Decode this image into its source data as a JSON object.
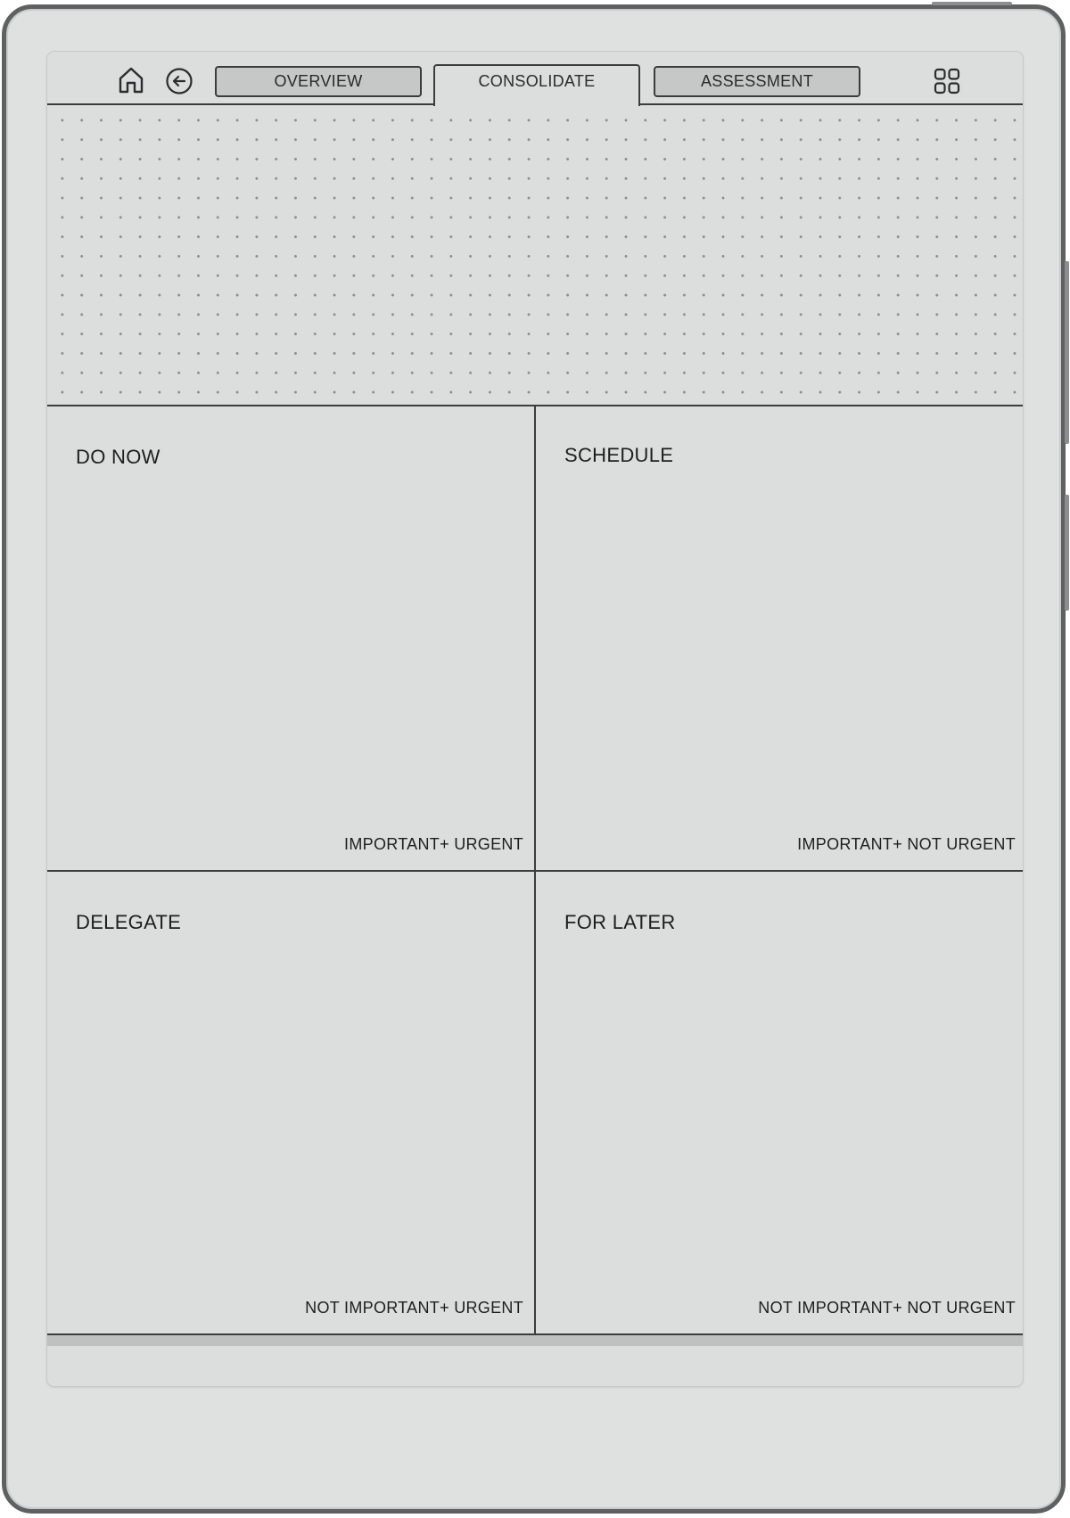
{
  "nav": {
    "home_icon": "home-icon",
    "back_icon": "back-arrow-icon",
    "tabs": [
      {
        "label": "OVERVIEW",
        "active": false
      },
      {
        "label": "CONSOLIDATE",
        "active": true
      },
      {
        "label": "ASSESSMENT",
        "active": false
      }
    ],
    "grid_icon": "grid-icon"
  },
  "matrix": {
    "quadrants": [
      {
        "title": "DO NOW",
        "subtitle": "IMPORTANT+ URGENT"
      },
      {
        "title": "SCHEDULE",
        "subtitle": "IMPORTANT+ NOT URGENT"
      },
      {
        "title": "DELEGATE",
        "subtitle": "NOT IMPORTANT+ URGENT"
      },
      {
        "title": "FOR LATER",
        "subtitle": "NOT IMPORTANT+ NOT URGENT"
      }
    ]
  },
  "colors": {
    "ink": "#3b3c3d",
    "screen": "#dcdddd",
    "tab_inactive": "#c6c7c7",
    "device_frame": "#5f6061"
  }
}
